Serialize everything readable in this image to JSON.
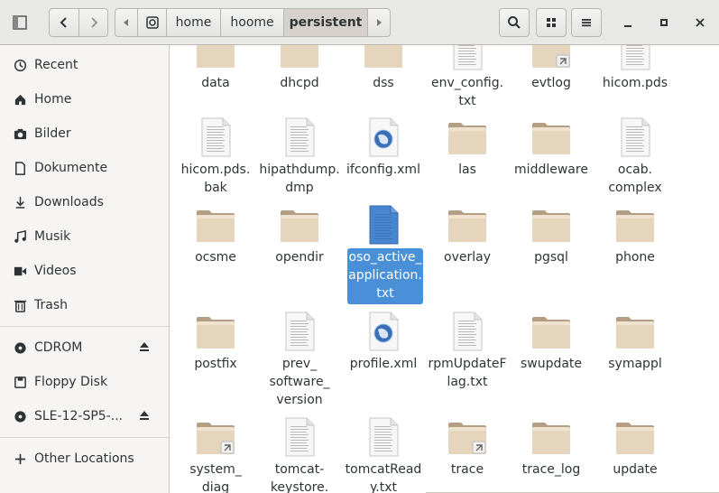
{
  "header": {
    "breadcrumbs": [
      "home",
      "hoome",
      "persistent"
    ]
  },
  "sidebar": {
    "places": [
      {
        "label": "Recent",
        "icon": "clock-icon"
      },
      {
        "label": "Home",
        "icon": "home-icon"
      },
      {
        "label": "Bilder",
        "icon": "camera-icon"
      },
      {
        "label": "Dokumente",
        "icon": "document-icon"
      },
      {
        "label": "Downloads",
        "icon": "download-icon"
      },
      {
        "label": "Musik",
        "icon": "music-icon"
      },
      {
        "label": "Videos",
        "icon": "video-icon"
      },
      {
        "label": "Trash",
        "icon": "trash-icon"
      }
    ],
    "devices": [
      {
        "label": "CDROM",
        "icon": "disc-icon",
        "eject": true
      },
      {
        "label": "Floppy Disk",
        "icon": "floppy-icon",
        "eject": false
      },
      {
        "label": "SLE-12-SP5-...",
        "icon": "disc-icon",
        "eject": true
      }
    ],
    "other": {
      "label": "Other Locations",
      "icon": "plus-icon"
    }
  },
  "files": [
    {
      "name": "data",
      "type": "folder"
    },
    {
      "name": "dhcpd",
      "type": "folder"
    },
    {
      "name": "dss",
      "type": "folder"
    },
    {
      "name": "env_config.\ntxt",
      "type": "text"
    },
    {
      "name": "evtlog",
      "type": "folder-link"
    },
    {
      "name": "hicom.pds",
      "type": "text"
    },
    {
      "name": "hicom.pds.\nbak",
      "type": "text"
    },
    {
      "name": "hipathdump.\ndmp",
      "type": "text"
    },
    {
      "name": "ifconfig.xml",
      "type": "xml"
    },
    {
      "name": "las",
      "type": "folder"
    },
    {
      "name": "middleware",
      "type": "folder"
    },
    {
      "name": "ocab.\ncomplex",
      "type": "text"
    },
    {
      "name": "ocsme",
      "type": "folder"
    },
    {
      "name": "opendir",
      "type": "folder"
    },
    {
      "name": "oso_active_\napplication.\ntxt",
      "type": "text-selected",
      "selected": true
    },
    {
      "name": "overlay",
      "type": "folder"
    },
    {
      "name": "pgsql",
      "type": "folder"
    },
    {
      "name": "phone",
      "type": "folder"
    },
    {
      "name": "postfix",
      "type": "folder"
    },
    {
      "name": "prev_\nsoftware_\nversion",
      "type": "text"
    },
    {
      "name": "profile.xml",
      "type": "xml"
    },
    {
      "name": "rpmUpdateF\nlag.txt",
      "type": "text"
    },
    {
      "name": "swupdate",
      "type": "folder"
    },
    {
      "name": "symappl",
      "type": "folder"
    },
    {
      "name": "system_\ndiag",
      "type": "folder-link"
    },
    {
      "name": "tomcat-\nkeystore.",
      "type": "text"
    },
    {
      "name": "tomcatRead\ny.txt",
      "type": "text"
    },
    {
      "name": "trace",
      "type": "folder-link"
    },
    {
      "name": "trace_log",
      "type": "folder"
    },
    {
      "name": "update",
      "type": "folder"
    }
  ]
}
